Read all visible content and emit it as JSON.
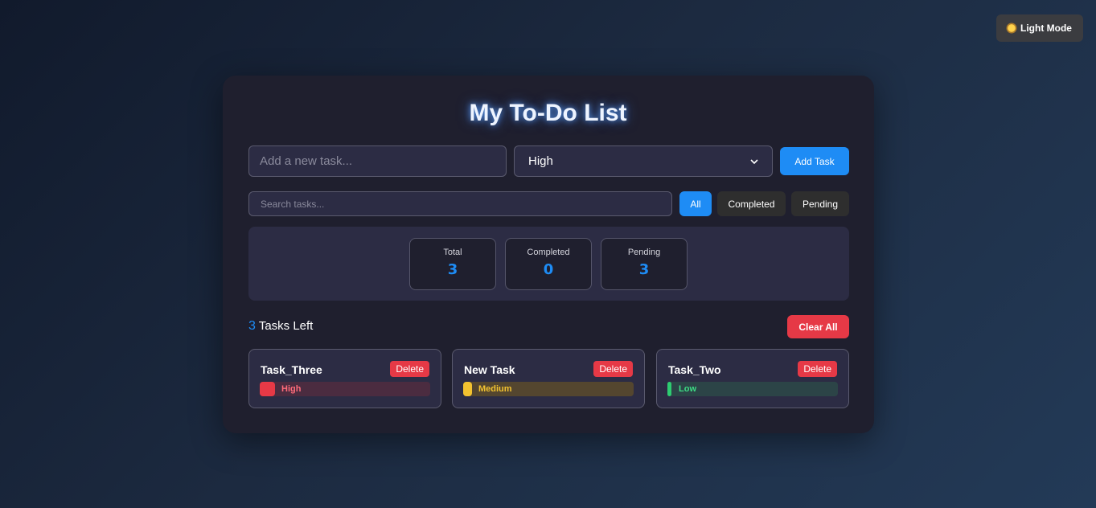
{
  "theme_toggle": {
    "label": "Light Mode",
    "icon": "sun-icon"
  },
  "app": {
    "title": "My To-Do List"
  },
  "new_task": {
    "placeholder": "Add a new task...",
    "priority_selected": "High",
    "add_label": "Add Task"
  },
  "search": {
    "placeholder": "Search tasks..."
  },
  "filters": {
    "all": "All",
    "completed": "Completed",
    "pending": "Pending",
    "active": "All"
  },
  "stats": [
    {
      "label": "Total",
      "value": "3"
    },
    {
      "label": "Completed",
      "value": "0"
    },
    {
      "label": "Pending",
      "value": "3"
    }
  ],
  "summary": {
    "count": "3",
    "label": "Tasks Left",
    "clear_label": "Clear All"
  },
  "tasks": [
    {
      "name": "Task_Three",
      "delete_label": "Delete",
      "priority": "High"
    },
    {
      "name": "New Task",
      "delete_label": "Delete",
      "priority": "Medium"
    },
    {
      "name": "Task_Two",
      "delete_label": "Delete",
      "priority": "Low"
    }
  ],
  "colors": {
    "accent": "#1e8cf5",
    "danger": "#e63946",
    "high": "#e63946",
    "medium": "#f2c230",
    "low": "#2ecc71",
    "card_bg": "#1f1f2e"
  }
}
